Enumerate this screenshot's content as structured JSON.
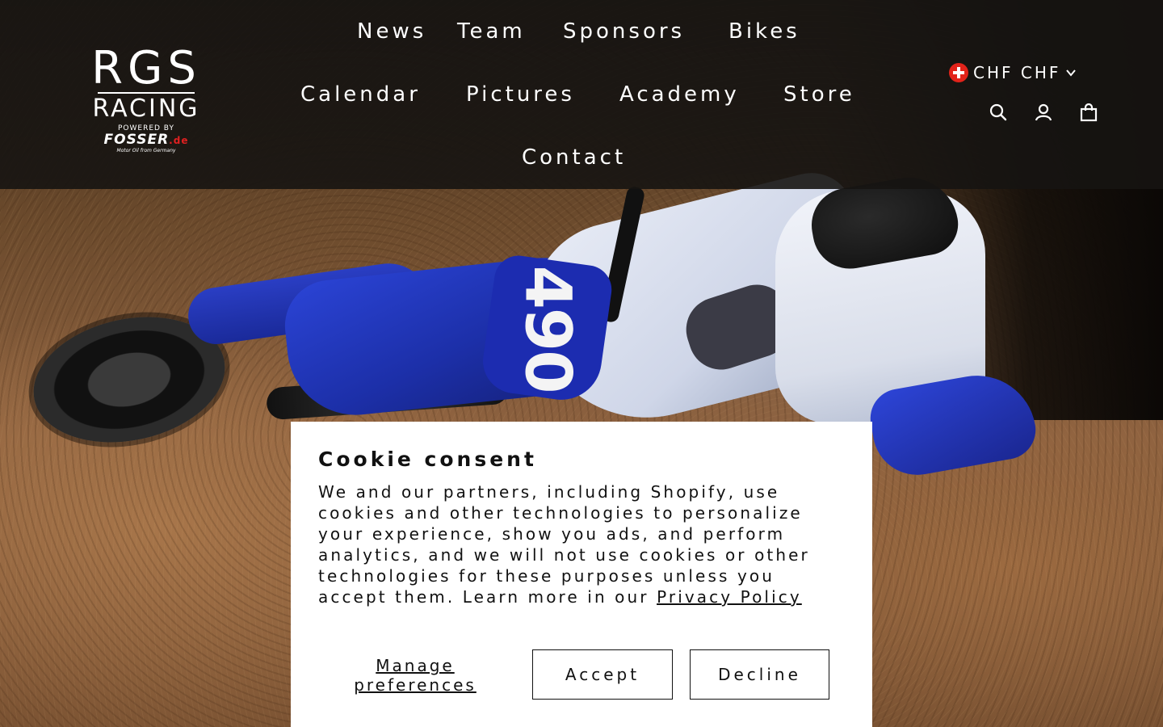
{
  "brand": {
    "logo_main": "RGS",
    "logo_sub": "RACING",
    "powered_by": "POWERED BY",
    "sponsor": "FOSSER",
    "sponsor_suffix": ".de",
    "sponsor_tagline": "Motor Oil from Germany"
  },
  "nav": {
    "items": [
      {
        "label": "News"
      },
      {
        "label": "Team"
      },
      {
        "label": "Sponsors"
      },
      {
        "label": "Bikes"
      },
      {
        "label": "Calendar"
      },
      {
        "label": "Pictures"
      },
      {
        "label": "Academy"
      },
      {
        "label": "Store"
      },
      {
        "label": "Contact"
      }
    ]
  },
  "currency": {
    "flag_icon": "swiss-flag-icon",
    "label": "CHF CHF",
    "dropdown_icon": "chevron-down-icon"
  },
  "header_icons": [
    "search-icon",
    "account-icon",
    "cart-icon"
  ],
  "hero": {
    "bike_number": "490"
  },
  "cookie": {
    "title": "Cookie consent",
    "body": "We and our partners, including Shopify, use cookies and other technologies to personalize your experience, show you ads, and perform analytics, and we will not use cookies or other technologies for these purposes unless you accept them. Learn more in our ",
    "policy_link": "Privacy Policy",
    "manage_label": "Manage preferences",
    "accept_label": "Accept",
    "decline_label": "Decline"
  },
  "colors": {
    "header_bg": "#161412",
    "bike_blue": "#1c2fa8",
    "flag_red": "#e2231a",
    "panel_bg": "#ffffff"
  }
}
